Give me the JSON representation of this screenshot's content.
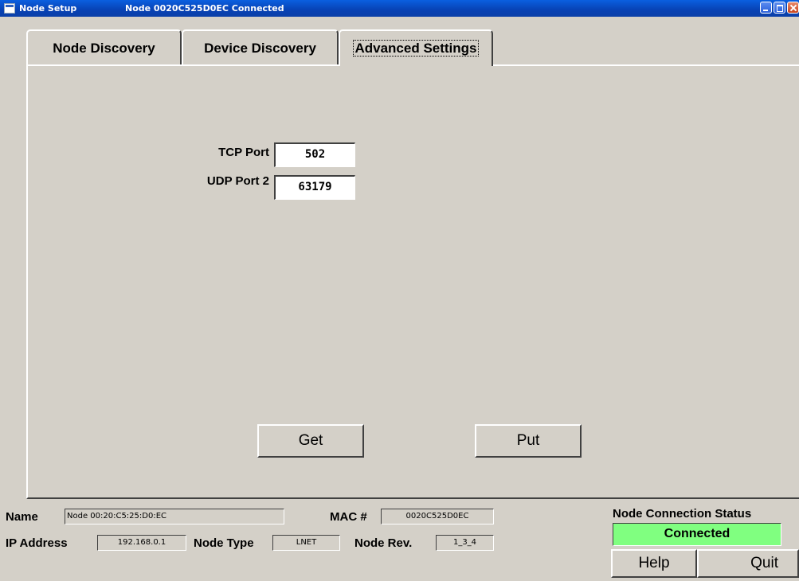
{
  "window": {
    "app_title": "Node Setup",
    "status_title": "Node 0020C525D0EC Connected"
  },
  "tabs": [
    {
      "label": "Node Discovery",
      "selected": false
    },
    {
      "label": "Device Discovery",
      "selected": false
    },
    {
      "label": "Advanced Settings",
      "selected": true
    }
  ],
  "advanced": {
    "tcp_label": "TCP Port",
    "tcp_value": "502",
    "udp_label": "UDP Port 2",
    "udp_value": "63179",
    "get_label": "Get",
    "put_label": "Put"
  },
  "node_info": {
    "name_label": "Name",
    "name_value": "Node 00:20:C5:25:D0:EC",
    "mac_label": "MAC #",
    "mac_value": "0020C525D0EC",
    "ip_label": "IP Address",
    "ip_value": "192.168.0.1",
    "type_label": "Node Type",
    "type_value": "LNET",
    "rev_label": "Node Rev.",
    "rev_value": "1_3_4"
  },
  "connection": {
    "title": "Node Connection Status",
    "status": "Connected",
    "status_color": "#80ff80"
  },
  "actions": {
    "help_label": "Help",
    "quit_label": "Quit"
  },
  "colors": {
    "titlebar": "#0842b4",
    "face": "#d4d0c8"
  },
  "icons": [
    "window-icon",
    "minimize-icon",
    "maximize-icon",
    "close-icon"
  ]
}
